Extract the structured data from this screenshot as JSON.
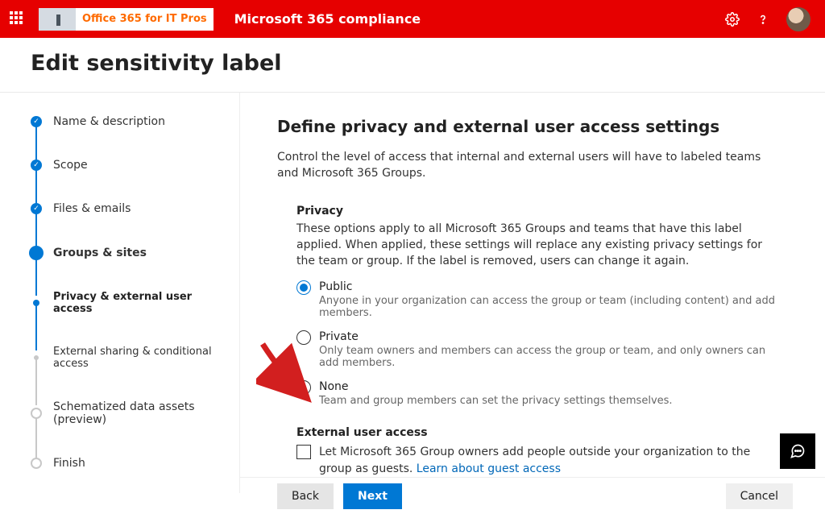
{
  "header": {
    "brand": "Office 365 for IT Pros",
    "app_title": "Microsoft 365 compliance"
  },
  "page_title": "Edit sensitivity label",
  "steps": {
    "name": "Name & description",
    "scope": "Scope",
    "files": "Files & emails",
    "groups": "Groups & sites",
    "privacy": "Privacy & external user access",
    "sharing": "External sharing & conditional access",
    "schematized": "Schematized data assets (preview)",
    "finish": "Finish"
  },
  "main": {
    "title": "Define privacy and external user access settings",
    "lead": "Control the level of access that internal and external users will have to labeled teams and Microsoft 365 Groups.",
    "privacy": {
      "heading": "Privacy",
      "desc": "These options apply to all Microsoft 365 Groups and teams that have this label applied. When applied, these settings will replace any existing privacy settings for the team or group. If the label is removed, users can change it again.",
      "options": {
        "public": {
          "label": "Public",
          "sub": "Anyone in your organization can access the group or team (including content) and add members."
        },
        "private": {
          "label": "Private",
          "sub": "Only team owners and members can access the group or team, and only owners can add members."
        },
        "none": {
          "label": "None",
          "sub": "Team and group members can set the privacy settings themselves."
        }
      }
    },
    "external": {
      "heading": "External user access",
      "checkbox": "Let Microsoft 365 Group owners add people outside your organization to the group as guests. ",
      "link": "Learn about guest access"
    }
  },
  "footer": {
    "back": "Back",
    "next": "Next",
    "cancel": "Cancel"
  }
}
